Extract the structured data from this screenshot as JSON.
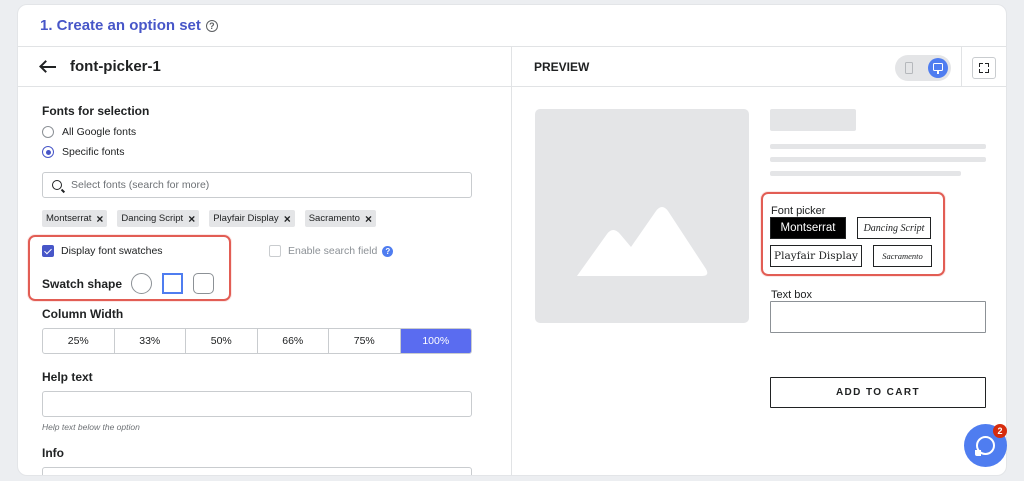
{
  "card": {
    "title": "1. Create an option set"
  },
  "editor": {
    "back_title": "font-picker-1",
    "fonts_section": {
      "label": "Fonts for selection",
      "options": [
        {
          "label": "All Google fonts",
          "selected": false
        },
        {
          "label": "Specific fonts",
          "selected": true
        }
      ]
    },
    "search": {
      "placeholder": "Select fonts (search for more)"
    },
    "tags": [
      "Montserrat",
      "Dancing Script",
      "Playfair Display",
      "Sacramento"
    ],
    "display_swatches": {
      "label": "Display font swatches",
      "checked": true
    },
    "enable_search": {
      "label": "Enable search field",
      "checked": false,
      "help": "?"
    },
    "swatch_shape": {
      "label": "Swatch shape",
      "options": [
        "circle",
        "square",
        "rounded"
      ],
      "selected": "square"
    },
    "column_width": {
      "label": "Column Width",
      "options": [
        "25%",
        "33%",
        "50%",
        "66%",
        "75%",
        "100%"
      ],
      "selected": "100%"
    },
    "help_text": {
      "label": "Help text",
      "value": "",
      "hint": "Help text below the option"
    },
    "info": {
      "label": "Info"
    }
  },
  "preview": {
    "header": "PREVIEW",
    "device": "desktop",
    "font_picker": {
      "label": "Font picker",
      "chips": [
        {
          "label": "Montserrat",
          "selected": true
        },
        {
          "label": "Dancing Script",
          "selected": false
        },
        {
          "label": "Playfair Display",
          "selected": false
        },
        {
          "label": "Sacramento",
          "selected": false
        }
      ]
    },
    "text_box": {
      "label": "Text box",
      "value": ""
    },
    "add_to_cart": "ADD TO CART"
  },
  "chat": {
    "badge_count": "2"
  },
  "colors": {
    "accent": "#4756c8",
    "primary_blue": "#4f7df0",
    "highlight": "#e25d54",
    "active_col": "#5a6cf0"
  }
}
